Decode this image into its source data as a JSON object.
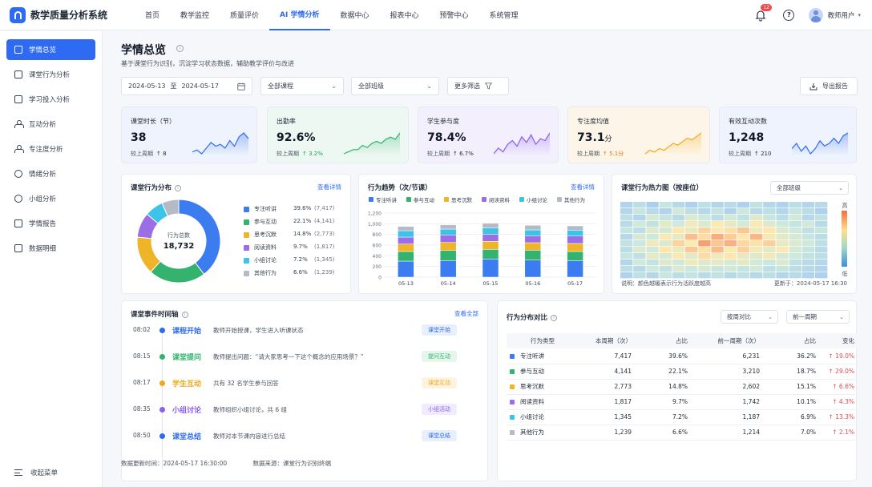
{
  "app": {
    "title": "教学质量分析系统"
  },
  "nav": {
    "items": [
      {
        "label": "首页",
        "active": false
      },
      {
        "label": "教学监控",
        "active": false
      },
      {
        "label": "质量评价",
        "active": false
      },
      {
        "label": "AI 学情分析",
        "active": true
      },
      {
        "label": "数据中心",
        "active": false
      },
      {
        "label": "报表中心",
        "active": false
      },
      {
        "label": "预警中心",
        "active": false
      },
      {
        "label": "系统管理",
        "active": false
      }
    ]
  },
  "header": {
    "notification_count": "12",
    "help": "?",
    "user_name": "教师用户"
  },
  "sidebar": {
    "items": [
      {
        "label": "学情总览",
        "icon": "monitor-icon",
        "active": true
      },
      {
        "label": "课堂行为分析",
        "icon": "camera-icon",
        "active": false
      },
      {
        "label": "学习投入分析",
        "icon": "screen-icon",
        "active": false
      },
      {
        "label": "互动分析",
        "icon": "nodes-icon",
        "active": false
      },
      {
        "label": "专注度分析",
        "icon": "people-icon",
        "active": false
      },
      {
        "label": "情绪分析",
        "icon": "smile-icon",
        "active": false
      },
      {
        "label": "小组分析",
        "icon": "group-icon",
        "active": false
      },
      {
        "label": "学情报告",
        "icon": "document-icon",
        "active": false
      },
      {
        "label": "数据明细",
        "icon": "table-icon",
        "active": false
      }
    ],
    "collapse_label": "收起菜单"
  },
  "page": {
    "title": "学情总览",
    "subtitle": "基于课堂行为识别，沉淀学习状态数据，辅助教学评价与改进"
  },
  "filters": {
    "date_start": "2024-05-13",
    "date_sep": "至",
    "date_end": "2024-05-17",
    "course": "全部课程",
    "class": "全部班级",
    "more": "更多筛选",
    "export": "导出报告"
  },
  "kpis": [
    {
      "label": "课堂时长（节）",
      "value": "38",
      "unit": "",
      "compare_label": "较上周期",
      "change": "↑ 8",
      "change_color": "#1f2937",
      "color": "#2f6bf2",
      "bg": "#eef3fd",
      "spark": [
        4,
        5,
        3,
        6,
        9,
        7,
        8,
        6,
        10,
        7,
        12,
        14,
        11
      ]
    },
    {
      "label": "出勤率",
      "value": "92.6%",
      "unit": "",
      "compare_label": "较上周期",
      "change": "↑ 3.2%",
      "change_color": "#1f9d55",
      "color": "#2fb36b",
      "bg": "#edf8f2",
      "spark": [
        3,
        4,
        5,
        5,
        7,
        6,
        8,
        9,
        8,
        10,
        11,
        10,
        13
      ]
    },
    {
      "label": "学生参与度",
      "value": "78.4%",
      "unit": "",
      "compare_label": "较上周期",
      "change": "↑ 6.7%",
      "change_color": "#1f2937",
      "color": "#8b5cf6",
      "bg": "#f3effd",
      "spark": [
        3,
        6,
        4,
        8,
        10,
        7,
        12,
        9,
        13,
        8,
        11,
        10,
        14
      ]
    },
    {
      "label": "专注度均值",
      "value": "73.1",
      "unit": "分",
      "compare_label": "较上周期",
      "change": "↑ 5.1分",
      "change_color": "#d97706",
      "color": "#f0a81a",
      "bg": "#fdf6e8",
      "spark": [
        2,
        4,
        3,
        5,
        4,
        6,
        8,
        7,
        9,
        11,
        10,
        12,
        14
      ]
    },
    {
      "label": "有效互动次数",
      "value": "1,248",
      "unit": "",
      "compare_label": "较上周期",
      "change": "↑ 210",
      "change_color": "#1f2937",
      "color": "#2f6bf2",
      "bg": "#eef3fd",
      "spark": [
        6,
        8,
        5,
        7,
        4,
        6,
        9,
        7,
        8,
        10,
        8,
        11,
        12
      ]
    }
  ],
  "behavior_dist": {
    "title": "课堂行为分布",
    "link": "查看详情",
    "total_label": "行为总数",
    "total_value": "18,732",
    "chart_data": {
      "type": "pie",
      "slices": [
        {
          "name": "专注听讲",
          "value": 7417,
          "pct": "39.6%",
          "count": "(7,417)",
          "color": "#3b7cf0"
        },
        {
          "name": "参与互动",
          "value": 4141,
          "pct": "22.1%",
          "count": "(4,141)",
          "color": "#34b36e"
        },
        {
          "name": "思考沉默",
          "value": 2773,
          "pct": "14.8%",
          "count": "(2,773)",
          "color": "#f0b429"
        },
        {
          "name": "阅读资料",
          "value": 1817,
          "pct": "9.7%",
          "count": "(1,817)",
          "color": "#9b6ee8"
        },
        {
          "name": "小组讨论",
          "value": 1345,
          "pct": "7.2%",
          "count": "(1,345)",
          "color": "#3cc4e8"
        },
        {
          "name": "其他行为",
          "value": 1239,
          "pct": "6.6%",
          "count": "(1,239)",
          "color": "#b4bac6"
        }
      ]
    }
  },
  "trend": {
    "title": "行为趋势（次/节课）",
    "link": "查看详情",
    "chart_data": {
      "type": "bar",
      "stacked": true,
      "categories": [
        "05-13",
        "05-14",
        "05-15",
        "05-16",
        "05-17"
      ],
      "ylim": [
        0,
        1200
      ],
      "yticks": [
        "0",
        "200",
        "400",
        "600",
        "800",
        "1,000",
        "1,200"
      ],
      "series": [
        {
          "name": "专注听讲",
          "color": "#3b7cf0",
          "values": [
            300,
            310,
            340,
            320,
            310
          ]
        },
        {
          "name": "参与互动",
          "color": "#34b36e",
          "values": [
            180,
            190,
            180,
            185,
            170
          ]
        },
        {
          "name": "思考沉默",
          "color": "#f0b429",
          "values": [
            140,
            150,
            150,
            140,
            150
          ]
        },
        {
          "name": "阅读资料",
          "color": "#9b6ee8",
          "values": [
            130,
            140,
            130,
            130,
            140
          ]
        },
        {
          "name": "小组讨论",
          "color": "#3cc4e8",
          "values": [
            120,
            110,
            120,
            110,
            110
          ]
        },
        {
          "name": "其他行为",
          "color": "#b4bac6",
          "values": [
            80,
            80,
            90,
            85,
            80
          ]
        }
      ]
    }
  },
  "heatmap": {
    "title": "课堂行为热力图（按座位）",
    "class_select": "全部班级",
    "legend_high": "高",
    "legend_low": "低",
    "note": "说明：颜色越暖表示行为活跃度越高",
    "updated": "更新于：2024-05-17 16:30",
    "chart_data": {
      "type": "heatmap",
      "rows": 12,
      "cols": 16,
      "values": [
        [
          0.22,
          0.3,
          0.18,
          0.35,
          0.26,
          0.2,
          0.31,
          0.24,
          0.28,
          0.19,
          0.33,
          0.25,
          0.21,
          0.29,
          0.23,
          0.27
        ],
        [
          0.25,
          0.36,
          0.28,
          0.22,
          0.4,
          0.3,
          0.26,
          0.34,
          0.22,
          0.38,
          0.27,
          0.31,
          0.24,
          0.35,
          0.29,
          0.2
        ],
        [
          0.31,
          0.24,
          0.42,
          0.35,
          0.28,
          0.45,
          0.38,
          0.3,
          0.41,
          0.33,
          0.47,
          0.36,
          0.29,
          0.4,
          0.26,
          0.33
        ],
        [
          0.28,
          0.4,
          0.33,
          0.48,
          0.39,
          0.52,
          0.44,
          0.57,
          0.49,
          0.42,
          0.55,
          0.46,
          0.38,
          0.34,
          0.41,
          0.27
        ],
        [
          0.35,
          0.3,
          0.47,
          0.41,
          0.58,
          0.5,
          0.63,
          0.55,
          0.6,
          0.66,
          0.52,
          0.58,
          0.45,
          0.39,
          0.32,
          0.36
        ],
        [
          0.26,
          0.43,
          0.38,
          0.55,
          0.49,
          0.68,
          0.61,
          0.72,
          0.65,
          0.58,
          0.7,
          0.54,
          0.47,
          0.42,
          0.36,
          0.29
        ],
        [
          0.33,
          0.37,
          0.52,
          0.46,
          0.63,
          0.57,
          0.75,
          0.66,
          0.71,
          0.62,
          0.59,
          0.64,
          0.5,
          0.44,
          0.39,
          0.31
        ],
        [
          0.29,
          0.45,
          0.4,
          0.58,
          0.51,
          0.66,
          0.6,
          0.69,
          0.56,
          0.64,
          0.53,
          0.48,
          0.55,
          0.41,
          0.35,
          0.28
        ],
        [
          0.36,
          0.32,
          0.49,
          0.43,
          0.55,
          0.47,
          0.61,
          0.52,
          0.58,
          0.5,
          0.46,
          0.53,
          0.42,
          0.38,
          0.33,
          0.3
        ],
        [
          0.24,
          0.39,
          0.34,
          0.46,
          0.4,
          0.52,
          0.45,
          0.49,
          0.43,
          0.48,
          0.41,
          0.37,
          0.44,
          0.32,
          0.28,
          0.25
        ],
        [
          0.3,
          0.27,
          0.38,
          0.33,
          0.44,
          0.37,
          0.42,
          0.36,
          0.4,
          0.34,
          0.39,
          0.31,
          0.35,
          0.29,
          0.26,
          0.23
        ],
        [
          0.21,
          0.31,
          0.25,
          0.36,
          0.29,
          0.34,
          0.28,
          0.33,
          0.27,
          0.32,
          0.26,
          0.3,
          0.24,
          0.28,
          0.22,
          0.2
        ]
      ]
    }
  },
  "timeline": {
    "title": "课堂事件时间轴",
    "link": "查看全部",
    "events": [
      {
        "time": "08:02",
        "event": "课程开始",
        "desc": "教师开始授课，学生进入听课状态",
        "tag": "课堂开始",
        "color": "#2f6bf2",
        "tag_bg": "#e8effd"
      },
      {
        "time": "08:15",
        "event": "课堂提问",
        "desc": "教师提出问题：“请大家思考一下这个概念的应用场景？”",
        "tag": "提问互动",
        "color": "#2fb36b",
        "tag_bg": "#e6f6ec"
      },
      {
        "time": "08:17",
        "event": "学生互动",
        "desc": "共有 32 名学生参与回答",
        "tag": "课堂互动",
        "color": "#f0a81a",
        "tag_bg": "#fdf3e0"
      },
      {
        "time": "08:35",
        "event": "小组讨论",
        "desc": "教师组织小组讨论，共 6 组",
        "tag": "小组活动",
        "color": "#8b5cf6",
        "tag_bg": "#f0ebfd"
      },
      {
        "time": "08:50",
        "event": "课堂总结",
        "desc": "教师对本节课内容进行总结",
        "tag": "课堂总结",
        "color": "#2f6bf2",
        "tag_bg": "#e8effd"
      }
    ]
  },
  "compare": {
    "title": "行为分布对比",
    "mode_select": "按周对比",
    "period_select": "前一周期",
    "headers": [
      "行为类型",
      "本周期（次）",
      "占比",
      "前一周期（次）",
      "占比",
      "变化"
    ],
    "rows": [
      {
        "color": "#3b7cf0",
        "type": "专注听讲",
        "cur": "7,417",
        "cur_pct": "39.6%",
        "prev": "6,231",
        "prev_pct": "36.2%",
        "change": "↑ 19.0%"
      },
      {
        "color": "#34b36e",
        "type": "参与互动",
        "cur": "4,141",
        "cur_pct": "22.1%",
        "prev": "3,210",
        "prev_pct": "18.7%",
        "change": "↑ 29.0%"
      },
      {
        "color": "#f0b429",
        "type": "思考沉默",
        "cur": "2,773",
        "cur_pct": "14.8%",
        "prev": "2,602",
        "prev_pct": "15.1%",
        "change": "↑ 6.6%"
      },
      {
        "color": "#9b6ee8",
        "type": "阅读资料",
        "cur": "1,817",
        "cur_pct": "9.7%",
        "prev": "1,742",
        "prev_pct": "10.1%",
        "change": "↑ 4.3%"
      },
      {
        "color": "#3cc4e8",
        "type": "小组讨论",
        "cur": "1,345",
        "cur_pct": "7.2%",
        "prev": "1,187",
        "prev_pct": "6.9%",
        "change": "↑ 13.3%"
      },
      {
        "color": "#b4bac6",
        "type": "其他行为",
        "cur": "1,239",
        "cur_pct": "6.6%",
        "prev": "1,214",
        "prev_pct": "7.0%",
        "change": "↑ 2.1%"
      }
    ]
  },
  "footer": {
    "updated": "数据更新时间：2024-05-17 16:30:00",
    "source": "数据来源：课堂行为识别终端"
  }
}
